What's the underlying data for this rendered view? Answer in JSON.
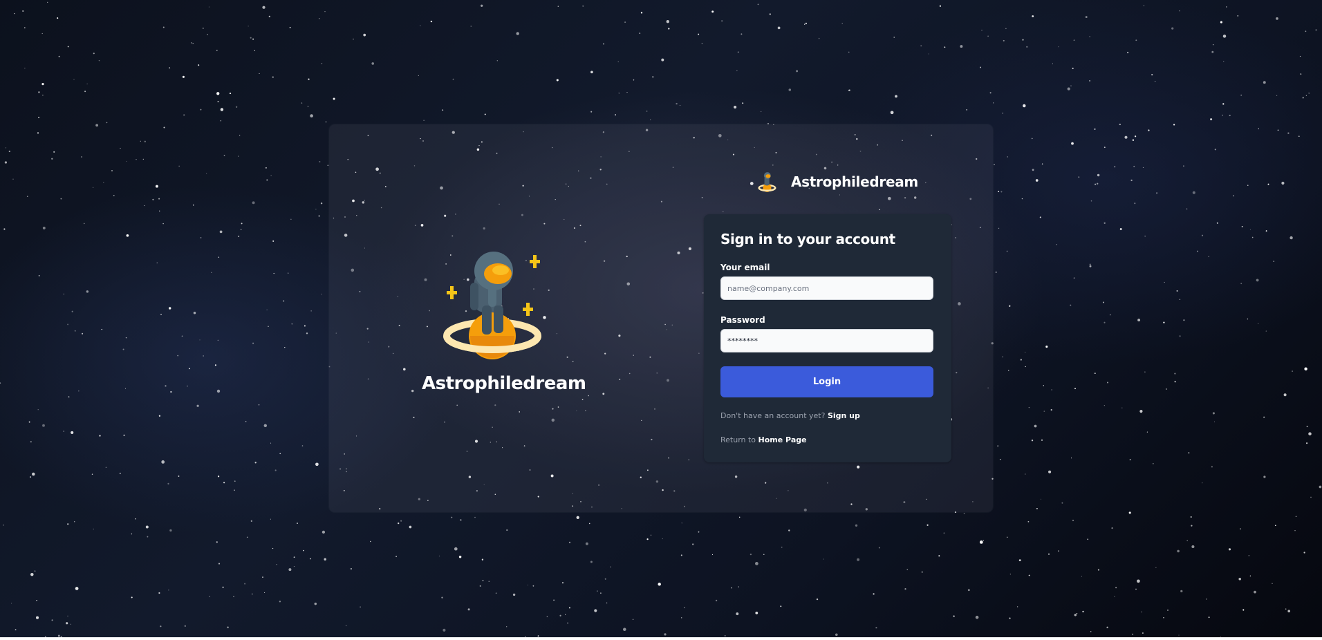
{
  "brand": {
    "name": "Astrophiledream"
  },
  "hero": {
    "title": "Astrophiledream"
  },
  "login_form": {
    "heading": "Sign in to your account",
    "email": {
      "label": "Your email",
      "placeholder": "name@company.com",
      "value": ""
    },
    "password": {
      "label": "Password",
      "placeholder": "••••••••",
      "value": "********"
    },
    "submit_label": "Login",
    "signup_prompt": "Don't have an account yet?",
    "signup_link": "Sign up",
    "return_prompt": "Return to",
    "home_link": "Home Page"
  },
  "icons": {
    "logo": "astronaut-on-planet-icon",
    "sparkles": "sparkle-icon"
  },
  "colors": {
    "accent": "#3b5bdb",
    "card_bg": "#1f2937",
    "planet": "#f59e0b",
    "ring": "#fde7b0",
    "suit": "#4b6070"
  }
}
